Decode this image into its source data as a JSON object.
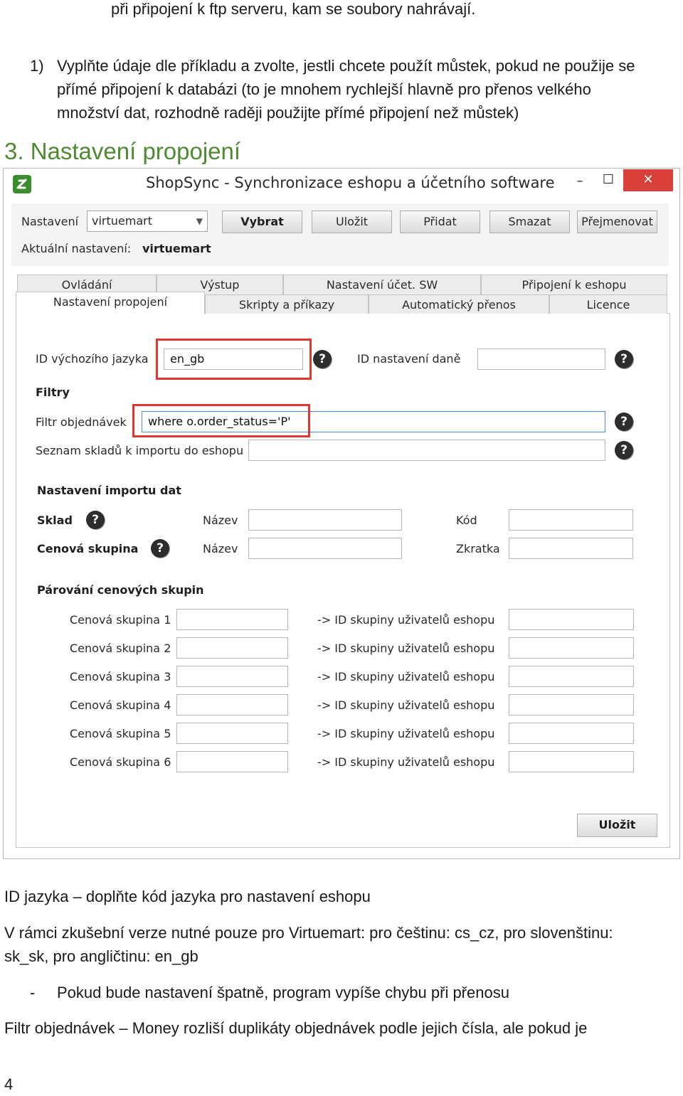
{
  "doc": {
    "line0": "při připojení k ftp serveru, kam se soubory nahrávají.",
    "step_num": "1)",
    "step_l1": "Vyplňte údaje dle příkladu a zvolte, jestli chcete použít můstek, pokud ne použije se",
    "step_l2": "přímé připojení k databázi (to je mnohem rychlejší hlavně pro přenos velkého",
    "step_l3": "množství dat, rozhodně raději použijte přímé připojení než můstek)",
    "heading": "3. Nastavení propojení",
    "p1": "ID jazyka – doplňte kód jazyka pro nastavení eshopu",
    "p2_l1": "V rámci zkušební verze nutné pouze pro Virtuemart: pro češtinu: cs_cz, pro slovenštinu:",
    "p2_l2": "sk_sk, pro angličtinu: en_gb",
    "bullet": "-",
    "bullet_text": "Pokud bude nastavení špatně, program vypíše chybu při přenosu",
    "p3": "Filtr objednávek – Money rozliší duplikáty objednávek podle jejich čísla, ale pokud je",
    "page_number": "4"
  },
  "window": {
    "title": "ShopSync - Synchronizace eshopu a účetního software",
    "minimize": "–",
    "maximize": "☐",
    "close": "✕"
  },
  "toolbar": {
    "nastaveni_label": "Nastavení",
    "nastaveni_value": "virtuemart",
    "vybrat": "Vybrat",
    "ulozit": "Uložit",
    "pridat": "Přidat",
    "smazat": "Smazat",
    "prejmenovat": "Přejmenovat",
    "aktualni_label": "Aktuální nastavení:",
    "aktualni_value": "virtuemart"
  },
  "tabs": {
    "row1": [
      "Ovládání",
      "Výstup",
      "Nastavení účet. SW",
      "Připojení k eshopu"
    ],
    "row2": [
      "Nastavení propojení",
      "Skripty a příkazy",
      "Automatický přenos",
      "Licence"
    ]
  },
  "form": {
    "id_jazyka_label": "ID výchozího jazyka",
    "id_jazyka_value": "en_gb",
    "id_dane_label": "ID nastavení daně",
    "id_dane_value": "",
    "filtry": "Filtry",
    "filtr_label": "Filtr objednávek",
    "filtr_value": "where o.order_status='P'",
    "sklady_label": "Seznam skladů k importu do eshopu",
    "sklady_value": "",
    "import_heading": "Nastavení importu dat",
    "sklad_label": "Sklad",
    "cenova_label": "Cenová skupina",
    "nazev_label": "Název",
    "kod_label": "Kód",
    "zkratka_label": "Zkratka",
    "parovani_heading": "Párování cenových skupin",
    "arrow_label": "-> ID skupiny uživatelů eshopu",
    "groups": [
      "Cenová skupina 1",
      "Cenová skupina 2",
      "Cenová skupina 3",
      "Cenová skupina 4",
      "Cenová skupina 5",
      "Cenová skupina 6"
    ],
    "help": "?",
    "save": "Uložit"
  }
}
